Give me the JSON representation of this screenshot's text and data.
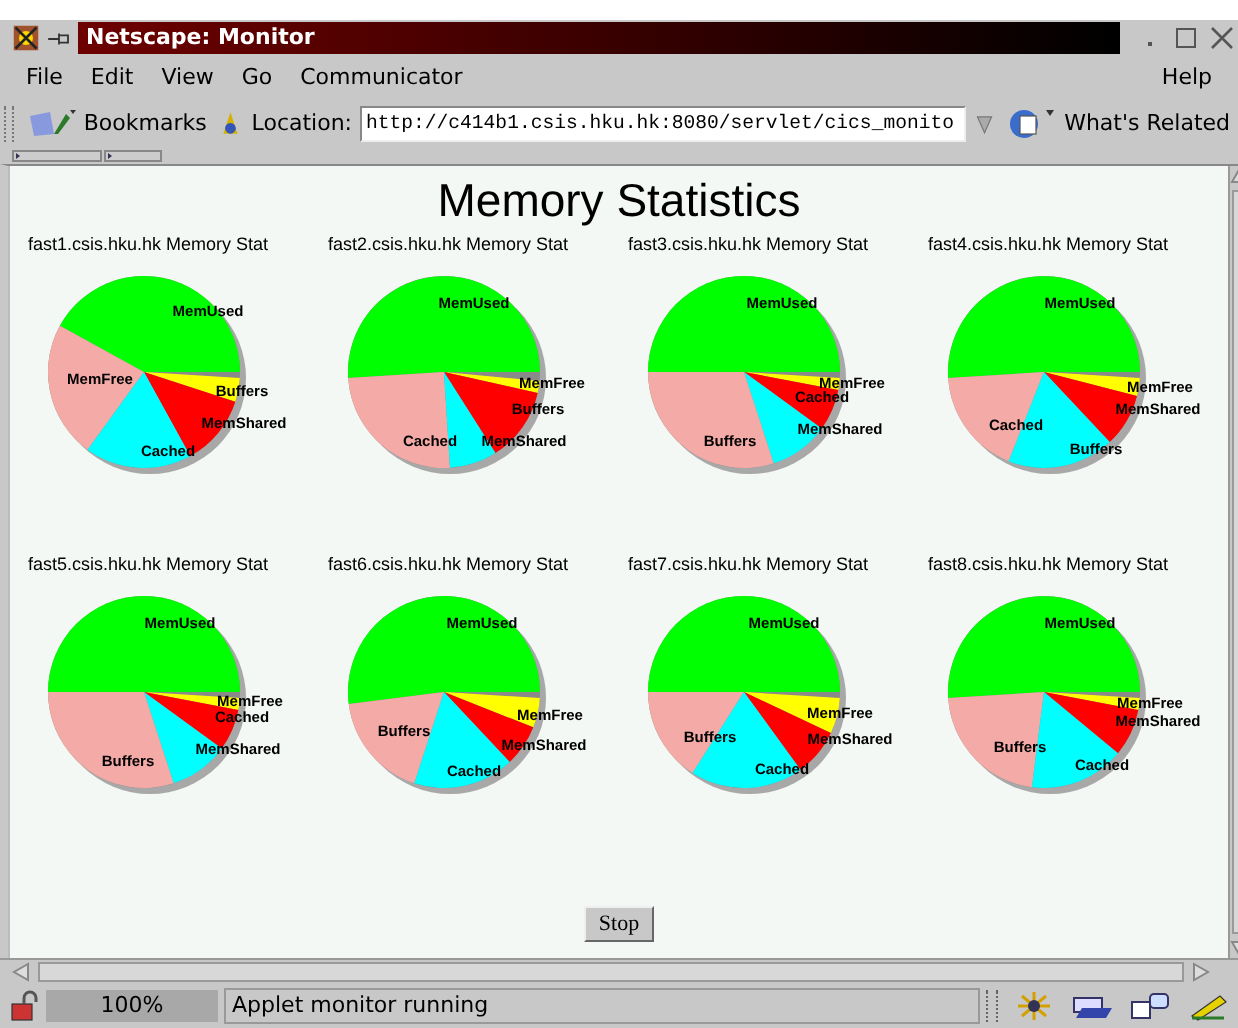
{
  "window": {
    "title": "Netscape: Monitor"
  },
  "menu": [
    {
      "label": "File"
    },
    {
      "label": "Edit"
    },
    {
      "label": "View"
    },
    {
      "label": "Go"
    },
    {
      "label": "Communicator"
    },
    {
      "label": "Help"
    }
  ],
  "toolbar": {
    "bookmarks": "Bookmarks",
    "location_label": "Location:",
    "url": "http://c414b1.csis.hku.hk:8080/servlet/cics_monito",
    "related": "What's Related"
  },
  "page": {
    "heading": "Memory Statistics",
    "pies": [
      {
        "title": "fast1.csis.hku.hk Memory Stat",
        "slices": [
          {
            "label": "MemUsed",
            "color": "#00ff00"
          },
          {
            "label": "MemFree",
            "color": "#f4aaa6"
          },
          {
            "label": "Buffers",
            "color": "#ffff00"
          },
          {
            "label": "MemShared",
            "color": "#ff0000"
          },
          {
            "label": "Cached",
            "color": "#00ffff"
          }
        ]
      },
      {
        "title": "fast2.csis.hku.hk Memory Stat",
        "slices": [
          {
            "label": "MemUsed",
            "color": "#00ff00"
          },
          {
            "label": "MemFree",
            "color": "#ffff00"
          },
          {
            "label": "Buffers",
            "color": "#ff0000"
          },
          {
            "label": "Cached",
            "color": "#f4aaa6"
          },
          {
            "label": "MemShared",
            "color": "#00ffff"
          }
        ]
      },
      {
        "title": "fast3.csis.hku.hk Memory Stat",
        "slices": [
          {
            "label": "MemUsed",
            "color": "#00ff00"
          },
          {
            "label": "MemFree",
            "color": "#ffff00"
          },
          {
            "label": "Cached",
            "color": "#ff0000"
          },
          {
            "label": "MemShared",
            "color": "#00ffff"
          },
          {
            "label": "Buffers",
            "color": "#f4aaa6"
          }
        ]
      },
      {
        "title": "fast4.csis.hku.hk Memory Stat",
        "slices": [
          {
            "label": "MemUsed",
            "color": "#00ff00"
          },
          {
            "label": "MemFree",
            "color": "#ffff00"
          },
          {
            "label": "MemShared",
            "color": "#ff0000"
          },
          {
            "label": "Cached",
            "color": "#f4aaa6"
          },
          {
            "label": "Buffers",
            "color": "#00ffff"
          }
        ]
      },
      {
        "title": "fast5.csis.hku.hk Memory Stat",
        "slices": [
          {
            "label": "MemUsed",
            "color": "#00ff00"
          },
          {
            "label": "MemFree",
            "color": "#ffff00"
          },
          {
            "label": "Cached",
            "color": "#ff0000"
          },
          {
            "label": "MemShared",
            "color": "#00ffff"
          },
          {
            "label": "Buffers",
            "color": "#f4aaa6"
          }
        ]
      },
      {
        "title": "fast6.csis.hku.hk Memory Stat",
        "slices": [
          {
            "label": "MemUsed",
            "color": "#00ff00"
          },
          {
            "label": "MemFree",
            "color": "#ffff00"
          },
          {
            "label": "Buffers",
            "color": "#f4aaa6"
          },
          {
            "label": "MemShared",
            "color": "#ff0000"
          },
          {
            "label": "Cached",
            "color": "#00ffff"
          }
        ]
      },
      {
        "title": "fast7.csis.hku.hk Memory Stat",
        "slices": [
          {
            "label": "MemUsed",
            "color": "#00ff00"
          },
          {
            "label": "MemFree",
            "color": "#ffff00"
          },
          {
            "label": "Buffers",
            "color": "#f4aaa6"
          },
          {
            "label": "MemShared",
            "color": "#ff0000"
          },
          {
            "label": "Cached",
            "color": "#00ffff"
          }
        ]
      },
      {
        "title": "fast8.csis.hku.hk Memory Stat",
        "slices": [
          {
            "label": "MemUsed",
            "color": "#00ff00"
          },
          {
            "label": "MemFree",
            "color": "#ffff00"
          },
          {
            "label": "MemShared",
            "color": "#ff0000"
          },
          {
            "label": "Buffers",
            "color": "#f4aaa6"
          },
          {
            "label": "Cached",
            "color": "#00ffff"
          }
        ]
      }
    ],
    "stop_button": "Stop"
  },
  "status_bar": {
    "zoom": "100%",
    "message": "Applet monitor running"
  }
}
